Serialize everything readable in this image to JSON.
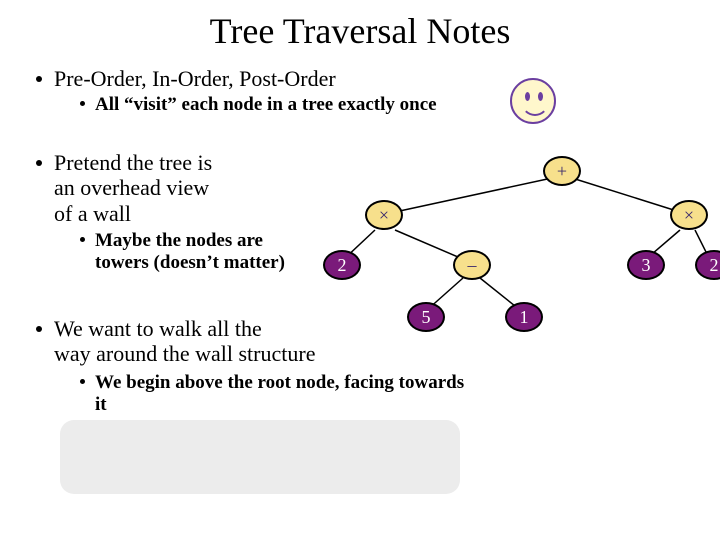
{
  "title": "Tree Traversal Notes",
  "bullets": {
    "b1": "Pre-Order, In-Order, Post-Order",
    "b1a": "All “visit” each node in a tree exactly once",
    "b2_line1": "Pretend the tree is",
    "b2_line2": "an overhead view",
    "b2_line3": "of a wall",
    "b2a_line1": "Maybe the nodes are",
    "b2a_line2": "towers (doesn’t matter)",
    "b3_line1": "We want to walk all the",
    "b3_line2": "way around the wall structure",
    "b3a_line1": "We begin above the root node, facing towards",
    "b3a_line2": "it"
  },
  "tree": {
    "root": "+",
    "l": "×",
    "r": "×",
    "ll": "2",
    "lr": "–",
    "lrl": "5",
    "lrr": "1",
    "rl": "3",
    "rr": "2"
  }
}
